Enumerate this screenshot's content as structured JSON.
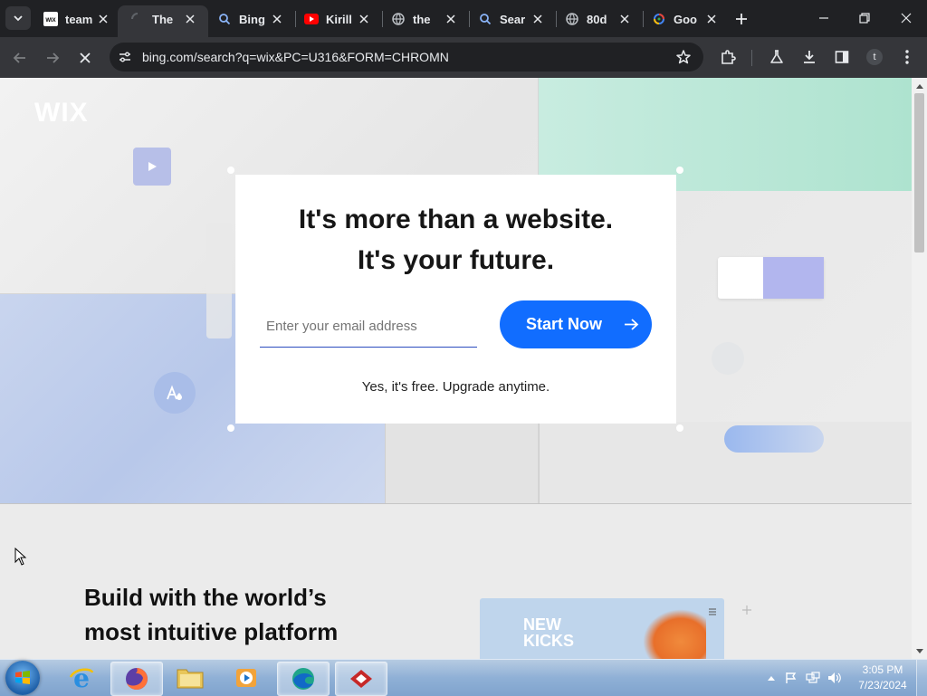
{
  "browser": {
    "tabs": [
      {
        "title": "team",
        "favicon": "wix-icon"
      },
      {
        "title": "The",
        "favicon": "loading-spinner-icon"
      },
      {
        "title": "Bing",
        "favicon": "search-icon"
      },
      {
        "title": "Kirill",
        "favicon": "youtube-icon"
      },
      {
        "title": "the",
        "favicon": "globe-icon"
      },
      {
        "title": "Sear",
        "favicon": "search-icon"
      },
      {
        "title": "80d",
        "favicon": "globe-icon"
      },
      {
        "title": "Goo",
        "favicon": "google-lens-icon"
      }
    ],
    "active_tab_index": 1,
    "url": "bing.com/search?q=wix&PC=U316&FORM=CHROMN",
    "profile_initial": "t"
  },
  "page": {
    "logo": "WIX",
    "hero_headline_1": "It's more than a website.",
    "hero_headline_2": "It's your future.",
    "email_placeholder": "Enter your email address",
    "cta_label": "Start Now",
    "cta_subtext": "Yes, it's free. Upgrade anytime.",
    "section_heading_1": "Build with the world’s",
    "section_heading_2": "most intuitive platform",
    "preview_text_1": "NEW",
    "preview_text_2": "KICKS",
    "colors": {
      "cta_blue": "#116dff",
      "hero_mint": "#aee3cf",
      "hero_blue": "#bccbeb",
      "browser_dark": "#202124"
    }
  },
  "taskbar": {
    "clock_time": "3:05 PM",
    "clock_date": "7/23/2024",
    "apps": [
      "start-orb",
      "internet-explorer",
      "firefox",
      "file-explorer",
      "media-player",
      "edge",
      "gifcam"
    ]
  }
}
